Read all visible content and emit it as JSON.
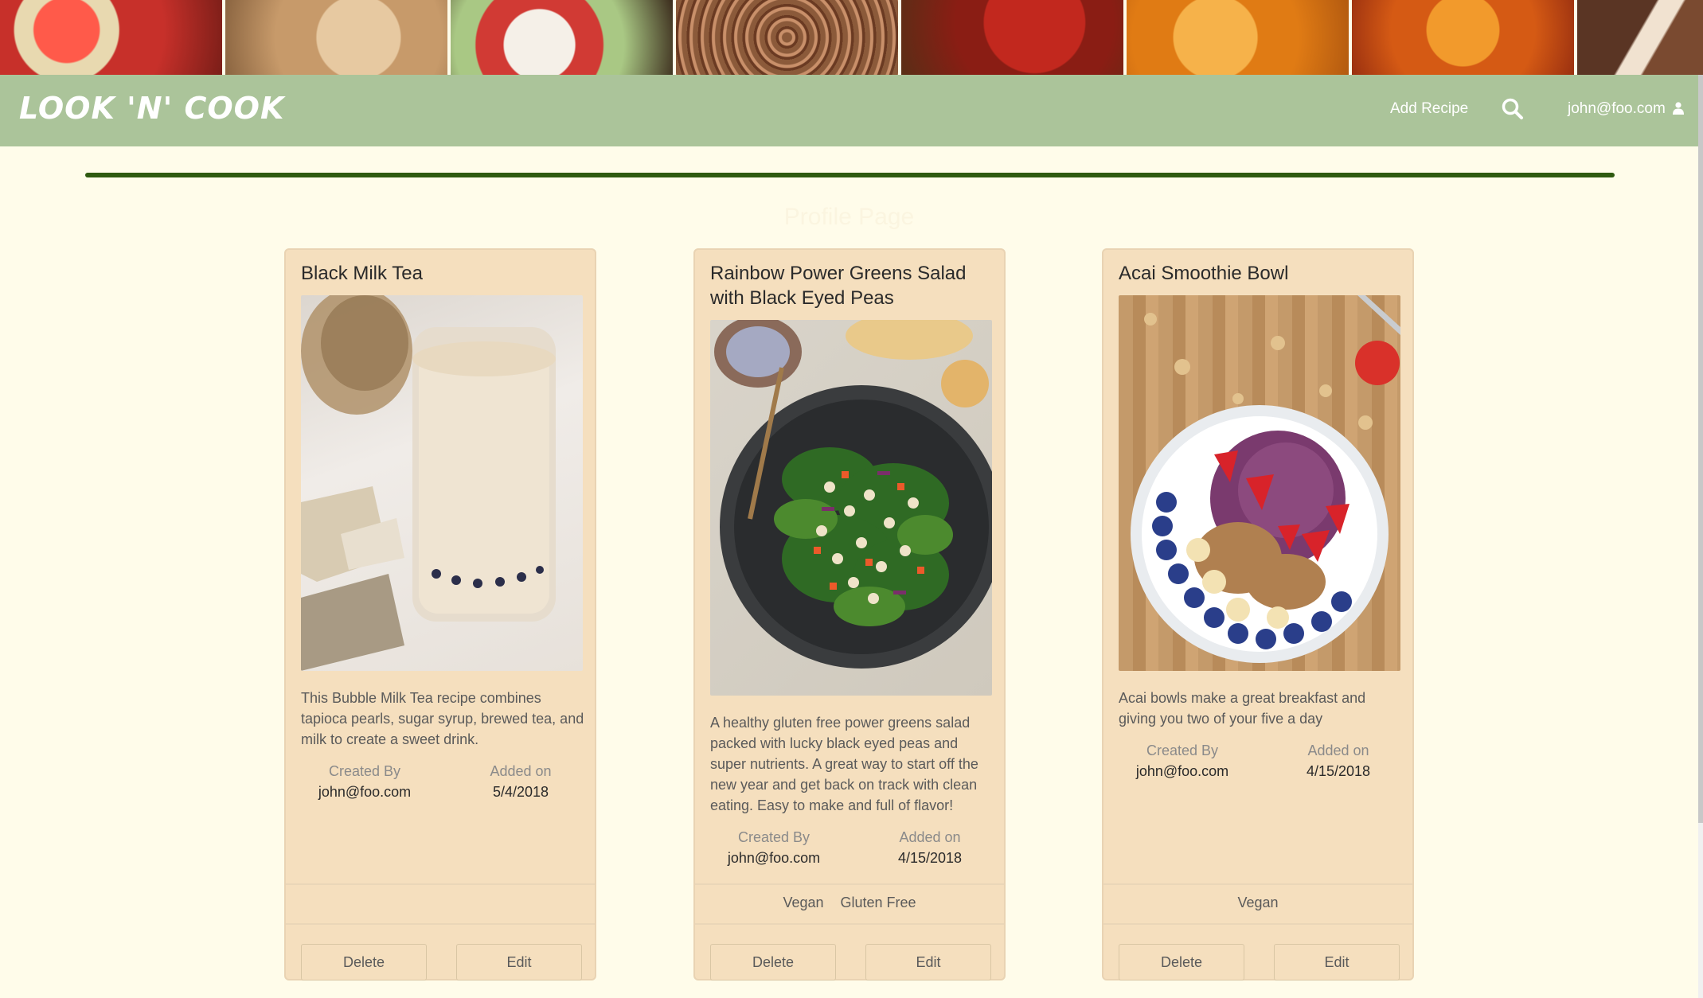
{
  "header": {
    "logo_text": "LOOK 'N' COOK",
    "nav": {
      "add_recipe": "Add Recipe",
      "search_icon": "search-icon",
      "user_email": "john@foo.com",
      "user_icon": "user-icon"
    }
  },
  "page": {
    "title": "Profile Page"
  },
  "recipes": [
    {
      "title": "Black Milk Tea",
      "description": "This Bubble Milk Tea recipe combines tapioca pearls, sugar syrup, brewed tea, and milk to create a sweet drink.",
      "created_by_label": "Created By",
      "created_by": "john@foo.com",
      "added_on_label": "Added on",
      "added_on": "5/4/2018",
      "tags": [],
      "delete_label": "Delete",
      "edit_label": "Edit"
    },
    {
      "title": "Rainbow Power Greens Salad with Black Eyed Peas",
      "description": "A healthy gluten free power greens salad packed with lucky black eyed peas and super nutrients. A great way to start off the new year and get back on track with clean eating. Easy to make and full of flavor!",
      "created_by_label": "Created By",
      "created_by": "john@foo.com",
      "added_on_label": "Added on",
      "added_on": "4/15/2018",
      "tags": [
        "Vegan",
        "Gluten Free"
      ],
      "delete_label": "Delete",
      "edit_label": "Edit"
    },
    {
      "title": "Acai Smoothie Bowl",
      "description": "Acai bowls make a great breakfast and giving you two of your five a day",
      "created_by_label": "Created By",
      "created_by": "john@foo.com",
      "added_on_label": "Added on",
      "added_on": "4/15/2018",
      "tags": [
        "Vegan"
      ],
      "delete_label": "Delete",
      "edit_label": "Edit"
    }
  ],
  "colors": {
    "navbar": "#abc49a",
    "page_background": "#fffcea",
    "card_background": "#f5dfbe",
    "divider": "#2f5a10"
  }
}
